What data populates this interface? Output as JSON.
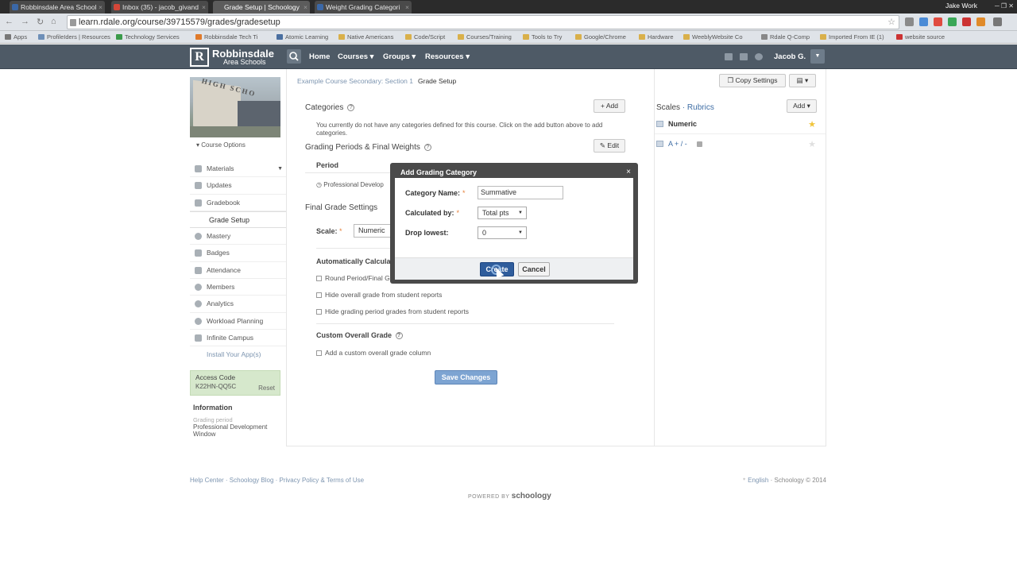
{
  "browser": {
    "tabs": [
      {
        "label": "Robbinsdale Area School",
        "color": "#3b68a8"
      },
      {
        "label": "Inbox (35) - jacob_givand",
        "color": "#d44638"
      },
      {
        "label": "Grade Setup | Schoology",
        "color": "#5c5c5c"
      },
      {
        "label": "Weight Grading Categori",
        "color": "#3b68a8"
      }
    ],
    "profile": "Jake Work",
    "url": "learn.rdale.org/course/39715579/grades/gradesetup",
    "bookmarks": [
      "Apps",
      "ProfileIders | Resources",
      "Technology Services",
      "Robbinsdale Tech Ti",
      "Atomic Learning",
      "Native Americans",
      "Code/Script",
      "Courses/Training",
      "Tools to Try",
      "Google/Chrome",
      "Hardware",
      "WeeblyWebsite Co",
      "Rdale Q-Comp",
      "Imported From IE (1)",
      "website source"
    ]
  },
  "header": {
    "logo_mark": "R",
    "logo_name": "Robbinsdale",
    "logo_sub": "Area Schools",
    "nav": [
      "Home",
      "Courses ▾",
      "Groups ▾",
      "Resources ▾"
    ],
    "user": "Jacob G.",
    "dropdown_icon": "▼"
  },
  "sidebar": {
    "course_image_text": "HIGH SCHO",
    "course_options": "Course Options",
    "items": [
      {
        "label": "Materials",
        "icon": "folder-icon"
      },
      {
        "label": "Updates",
        "icon": "updates-icon"
      },
      {
        "label": "Gradebook",
        "icon": "gradebook-icon"
      },
      {
        "label": "Grade Setup",
        "icon": ""
      },
      {
        "label": "Mastery",
        "icon": "mastery-icon"
      },
      {
        "label": "Badges",
        "icon": "badge-icon"
      },
      {
        "label": "Attendance",
        "icon": "attendance-icon"
      },
      {
        "label": "Members",
        "icon": "members-icon"
      },
      {
        "label": "Analytics",
        "icon": "analytics-icon"
      },
      {
        "label": "Workload Planning",
        "icon": "workload-icon"
      },
      {
        "label": "Infinite Campus",
        "icon": "campus-icon"
      }
    ],
    "install_apps": "Install Your App(s)",
    "access_code_title": "Access Code",
    "access_code": "K22HN-QQ5C",
    "access_reset": "Reset",
    "information_title": "Information",
    "grading_period_label": "Grading period",
    "grading_period_value": "Professional Development Window"
  },
  "main": {
    "breadcrumb_link": "Example Course Secondary: Section 1",
    "breadcrumb_current": "Grade Setup",
    "copy_settings": "Copy Settings",
    "categories_title": "Categories",
    "categories_add": "+ Add",
    "categories_note": "You currently do not have any categories defined for this course. Click on the add button above to add categories.",
    "grading_periods_title": "Grading Periods & Final Weights",
    "edit": "✎ Edit",
    "period_col": "Period",
    "period_row": "Professional Develop",
    "final_grade_title": "Final Grade Settings",
    "scale_label": "Scale:",
    "scale_value": "Numeric",
    "auto_calc": "Automatically Calculate",
    "check_round": "Round Period/Final G",
    "check_hide_overall": "Hide overall grade from student reports",
    "check_hide_period": "Hide grading period grades from student reports",
    "custom_overall_title": "Custom Overall Grade",
    "check_custom": "Add a custom overall grade column",
    "save": "Save Changes"
  },
  "scales": {
    "title": "Scales",
    "sep": "·",
    "rubrics": "Rubrics",
    "add": "Add ▾",
    "items": [
      {
        "label": "Numeric",
        "star": "★",
        "star_color": "#f0c43a"
      },
      {
        "label": "A + / -",
        "star": "★",
        "star_color": "#e0e0e0"
      }
    ]
  },
  "modal": {
    "title": "Add Grading Category",
    "close": "×",
    "category_name_label": "Category Name:",
    "category_name_value": "Summative",
    "calculated_by_label": "Calculated by:",
    "calculated_by_value": "Total pts",
    "drop_lowest_label": "Drop lowest:",
    "drop_lowest_value": "0",
    "required": "*",
    "create": "Create",
    "cancel": "Cancel"
  },
  "footer": {
    "links": "Help Center · Schoology Blog · Privacy Policy & Terms of Use",
    "language": "English",
    "copyright": "Schoology © 2014",
    "powered_by": "POWERED BY",
    "brand": "schoology"
  }
}
